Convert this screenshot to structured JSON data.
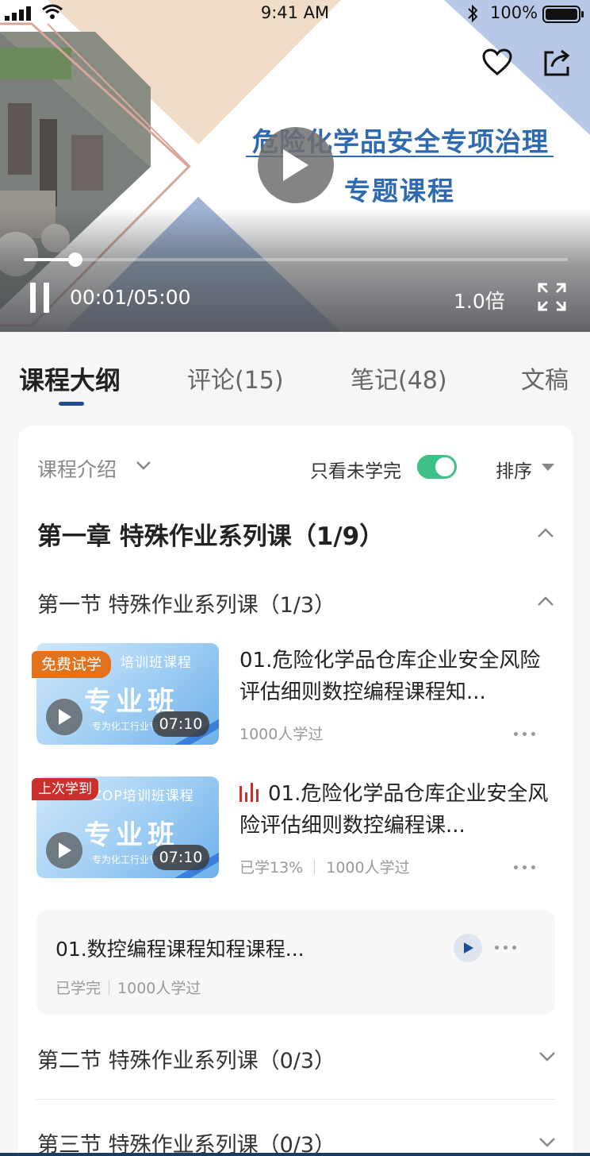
{
  "status_bar": {
    "time": "9:41 AM",
    "battery": "100%"
  },
  "video": {
    "banner_title": "危险化学品安全专项治理",
    "banner_subtitle": "专题课程",
    "current_time": "00:01",
    "total_time": "05:00",
    "time_display": "00:01/05:00",
    "progress_fraction": 0.095,
    "speed": "1.0倍"
  },
  "tabs": [
    {
      "label": "课程大纲",
      "active": true
    },
    {
      "label": "评论(15)",
      "active": false
    },
    {
      "label": "笔记(48)",
      "active": false
    },
    {
      "label": "文稿",
      "active": false
    }
  ],
  "outline": {
    "intro_label": "课程介绍",
    "filter_label": "只看未学完",
    "filter_on": true,
    "sort_label": "排序",
    "chapter_title": "第一章   特殊作业系列课（1/9）",
    "section1_title": "第一节 特殊作业系列课（1/3）",
    "lessons": [
      {
        "badge": "免费试学",
        "thumb_top": "培训班课程",
        "thumb_main": "专业班",
        "thumb_small": "专为化工行业专业技术",
        "duration": "07:10",
        "title": "01.危险化学品仓库企业安全风险评估细则数控编程课程知...",
        "learners": "1000人学过"
      },
      {
        "badge": "上次学到",
        "thumb_top": "HAZOP培训班课程",
        "thumb_main": "专业班",
        "thumb_small": "专为化工行业专业技术",
        "duration": "07:10",
        "title": "01.危险化学品仓库企业安全风险评估细则数控编程课...",
        "progress": "已学13%",
        "learners": "1000人学过"
      }
    ],
    "text_lesson": {
      "title": "01.数控编程课程知程课程...",
      "status": "已学完",
      "learners": "1000人学过"
    },
    "section2_title": "第二节 特殊作业系列课（0/3）",
    "section3_title": "第三节 特殊作业系列课（0/3）"
  },
  "colors": {
    "accent": "#1e4f95",
    "toggle": "#3ec189",
    "badge_orange": "#e2721c",
    "badge_red": "#c9302c",
    "banner_text": "#2e6ab2"
  }
}
